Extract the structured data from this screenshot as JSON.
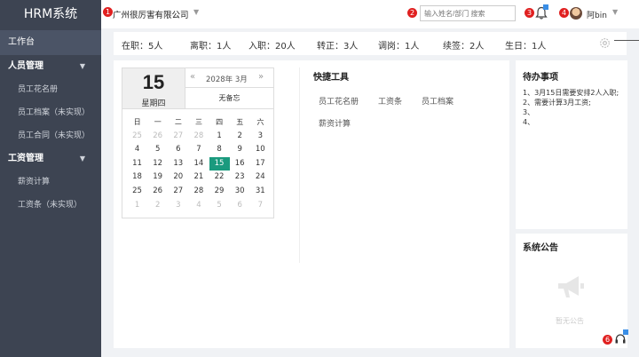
{
  "sidebar": {
    "app_title": "HRM系统",
    "active_item": "工作台",
    "groups": [
      {
        "label": "人员管理",
        "items": [
          "员工花名册",
          "员工档案（未实现）",
          "员工合同（未实现）"
        ]
      },
      {
        "label": "工资管理",
        "items": [
          "薪资计算",
          "工资条（未实现）"
        ]
      }
    ]
  },
  "header": {
    "company": "广州很厉害有限公司",
    "search_placeholder": "输入姓名/部门 搜索",
    "username": "阿bin",
    "badges": [
      "1",
      "2",
      "3",
      "4",
      "6"
    ]
  },
  "stats": [
    {
      "label": "在职：5人"
    },
    {
      "label": "离职：1人"
    },
    {
      "label": "入职：20人"
    },
    {
      "label": "转正：3人"
    },
    {
      "label": "调岗：1人"
    },
    {
      "label": "续签：2人"
    },
    {
      "label": "生日：1人"
    }
  ],
  "calendar": {
    "day": "15",
    "weekday": "星期四",
    "prev": "«",
    "next": "»",
    "month_label": "2028年  3月",
    "note": "无备忘",
    "weekdays": [
      "日",
      "一",
      "二",
      "三",
      "四",
      "五",
      "六"
    ],
    "weeks": [
      [
        {
          "d": "25",
          "m": 1
        },
        {
          "d": "26",
          "m": 1
        },
        {
          "d": "27",
          "m": 1
        },
        {
          "d": "28",
          "m": 1
        },
        {
          "d": "1"
        },
        {
          "d": "2"
        },
        {
          "d": "3"
        }
      ],
      [
        {
          "d": "4"
        },
        {
          "d": "5"
        },
        {
          "d": "6"
        },
        {
          "d": "7"
        },
        {
          "d": "8"
        },
        {
          "d": "9"
        },
        {
          "d": "10"
        }
      ],
      [
        {
          "d": "11"
        },
        {
          "d": "12"
        },
        {
          "d": "13"
        },
        {
          "d": "14"
        },
        {
          "d": "15",
          "t": 1
        },
        {
          "d": "16"
        },
        {
          "d": "17"
        }
      ],
      [
        {
          "d": "18"
        },
        {
          "d": "19"
        },
        {
          "d": "20"
        },
        {
          "d": "21"
        },
        {
          "d": "22"
        },
        {
          "d": "23"
        },
        {
          "d": "24"
        }
      ],
      [
        {
          "d": "25"
        },
        {
          "d": "26"
        },
        {
          "d": "27"
        },
        {
          "d": "28"
        },
        {
          "d": "29"
        },
        {
          "d": "30"
        },
        {
          "d": "31"
        }
      ],
      [
        {
          "d": "1",
          "m": 1
        },
        {
          "d": "2",
          "m": 1
        },
        {
          "d": "3",
          "m": 1
        },
        {
          "d": "4",
          "m": 1
        },
        {
          "d": "5",
          "m": 1
        },
        {
          "d": "6",
          "m": 1
        },
        {
          "d": "7",
          "m": 1
        }
      ]
    ]
  },
  "tools": {
    "title": "快捷工具",
    "items": [
      "员工花名册",
      "工资条",
      "员工档案",
      "薪资计算"
    ]
  },
  "todo": {
    "title": "待办事项",
    "lines": [
      "1、3月15日需要安排2人入职;",
      "2、需要计算3月工资;",
      "3、",
      "4、"
    ]
  },
  "notice": {
    "title": "系统公告",
    "empty_text": "暂无公告"
  },
  "colors": {
    "sidebar_bg": "#3d4452",
    "accent_today": "#1a9a7e",
    "badge": "#e02020"
  }
}
